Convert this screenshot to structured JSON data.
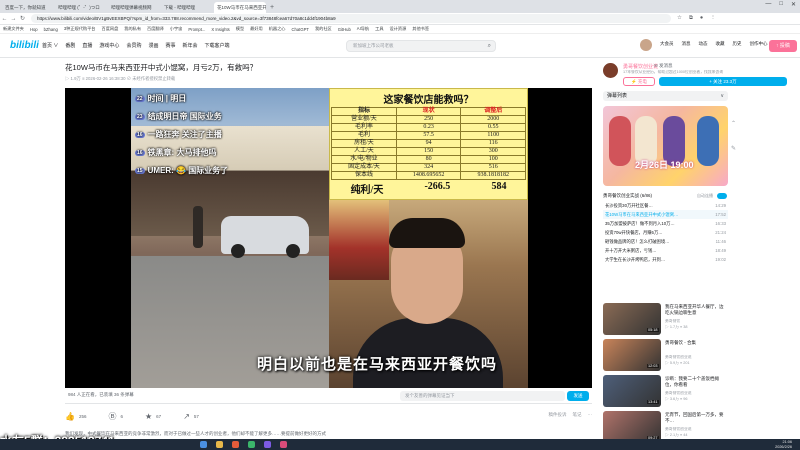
{
  "browser": {
    "tabs": [
      {
        "label": "百度一下，你就知道",
        "active": false
      },
      {
        "label": "哔哩哔哩 (゜-゜)つロ",
        "active": false
      },
      {
        "label": "哔哩哔哩弹幕视频网",
        "active": false
      },
      {
        "label": "下载 - 哔哩哔哩",
        "active": false
      },
      {
        "label": "花10W马币在马来西亚开中式",
        "active": true
      }
    ],
    "new_tab": "+",
    "window_controls": [
      "—",
      "□",
      "✕"
    ],
    "url": "https://www.bilibili.com/video/BV1gBvEEXBPQ/?spm_id_from=333.788.recommend_more_video.2&vd_source=3f73848fcea67d70a8c1dd4f1904b8a9",
    "bookmarks": [
      "新建文件夹",
      "Hop",
      "bZhang",
      "3种正规代购平台",
      "百度网盘",
      "我的私有",
      "百度翻译",
      "小宇宙",
      "Prompt...",
      "X Insights",
      "模型",
      "最好用",
      "机器之心",
      "ChatGPT",
      "我的社区",
      "GitHub",
      "AI导航",
      "工具",
      "设计资源",
      "其他书签"
    ]
  },
  "site": {
    "logo": "bilibili",
    "nav": [
      "首页 ∨",
      "番剧",
      "直播",
      "游戏中心",
      "会员购",
      "漫画",
      "赛事",
      "新年会",
      "下载客户端"
    ],
    "search_placeholder": "新加坡上市公司老板",
    "user_menu": [
      "大会员",
      "消息",
      "动态",
      "收藏",
      "历史",
      "创作中心"
    ],
    "upload": "↑ 投稿"
  },
  "video": {
    "title": "花10W马币在马来西亚开中式小馄窝，月亏2万，有救吗？",
    "meta": "▷ 1.9万   ≡ 2026-02-26 16:38:30   ⊘ 未经作者授权禁止转载",
    "chat": [
      {
        "lvl": "22",
        "text": "时间 | 明日"
      },
      {
        "lvl": "23",
        "text": "结成明日帝  国际业务"
      },
      {
        "lvl": "16",
        "text": "一路狂奔 关注了主播"
      },
      {
        "lvl": "16",
        "text": "铁黑章: 大马排他吗"
      },
      {
        "lvl": "15",
        "text": "UMER: 😂 国际业务了"
      }
    ],
    "panel": {
      "title": "这家餐饮店能救吗？",
      "headers": [
        "指标",
        "现状",
        "调整后"
      ],
      "rows": [
        [
          "营业额/天",
          "250",
          "2000"
        ],
        [
          "毛利率",
          "0.23",
          "0.55"
        ],
        [
          "毛利",
          "57.5",
          "1100"
        ],
        [
          "房租/天",
          "94",
          "116"
        ],
        [
          "人工/天",
          "150",
          "300"
        ],
        [
          "水/电/物业",
          "80",
          "100"
        ],
        [
          "固定成本/天",
          "324",
          "516"
        ],
        [
          "保本线",
          "1408.695652",
          "938.1818182"
        ]
      ],
      "profit_label": "纯利/天",
      "profit_current": "-266.5",
      "profit_after": "584"
    },
    "subtitle": "明白以前也是在马来西亚开餐饮吗",
    "viewers": "984 人正在看，已装填 36 条弹幕",
    "danmaku_placeholder": "发个友善的弹幕见证当下",
    "danmaku_send": "发送",
    "actions": [
      {
        "icon": "👍",
        "name": "like",
        "count": "256"
      },
      {
        "icon": "Ⓑ",
        "name": "coin",
        "count": "6"
      },
      {
        "icon": "★",
        "name": "favorite",
        "count": "67"
      },
      {
        "icon": "↗",
        "name": "share",
        "count": "57"
      }
    ],
    "action_right": [
      "稿件投诉",
      "笔记",
      "⋯"
    ],
    "description": "我们发现，中式餐饮在马来西亚的竞争非常激烈，而对于已做过一些人才的创业者，他们却不能了解更多……要提前做好更好的方式"
  },
  "overlay_text": "水友5群：292513741",
  "sidebar": {
    "up_name": "勇哥餐饮创业说",
    "up_msg": "✉ 发消息",
    "up_desc": "17年餐饮从业经历，帮助过超过1000位创业者，找我来咨询",
    "charge": "⚡ 充电",
    "follow": "+ 关注 23.3万",
    "danmaku_list": "弹幕列表",
    "ad_date": "2月26日 19:00",
    "collection_title": "勇哥餐饮创业实战 (6/86)",
    "autoplay": "自动连播",
    "collection": [
      {
        "title": "长沙投资30万开社区餐…",
        "dur": "14:29",
        "active": false
      },
      {
        "title": "花10W马币在马来西亚开中式小馄窝…",
        "dur": "17:52",
        "active": true
      },
      {
        "title": "35万加盟披萨店！做不到月入10万…",
        "dur": "16:33",
        "active": false
      },
      {
        "title": "投资70w开快餐店，月赚5万…",
        "dur": "21:24",
        "active": false
      },
      {
        "title": "砸钱做品牌的店！怎么打破困境…",
        "dur": "11:46",
        "active": false
      },
      {
        "title": "开十万开大米粥店，亏钱…",
        "dur": "18:49",
        "active": false
      },
      {
        "title": "大学生在长沙开烤鸭店，开到…",
        "dur": "19:02",
        "active": false
      }
    ],
    "recommend": [
      {
        "title": "我在马来西亚开华人餐厅，边吃火锅边聊生意",
        "up": "勇哥餐饮",
        "stat": "▷ 1.7万  ≡ 38",
        "dur": "05:18"
      },
      {
        "title": "勇哥餐饮 - 合集",
        "up": "勇哥餐饮创业说",
        "stat": "▷ 5.9万  ≡ 201",
        "dur": "12:03"
      },
      {
        "title": "诊断：我要二十个盖饭档摊位，你看看",
        "up": "勇哥餐饮创业说",
        "stat": "▷ 3.6万  ≡ 96",
        "dur": "13:41"
      },
      {
        "title": "元宵节，回国后第一万多，要不…",
        "up": "勇哥餐饮创业说",
        "stat": "▷ 2.1万  ≡ 44",
        "dur": "09:27"
      }
    ]
  },
  "taskbar": {
    "time": "21:06",
    "date": "2026/2/26"
  }
}
